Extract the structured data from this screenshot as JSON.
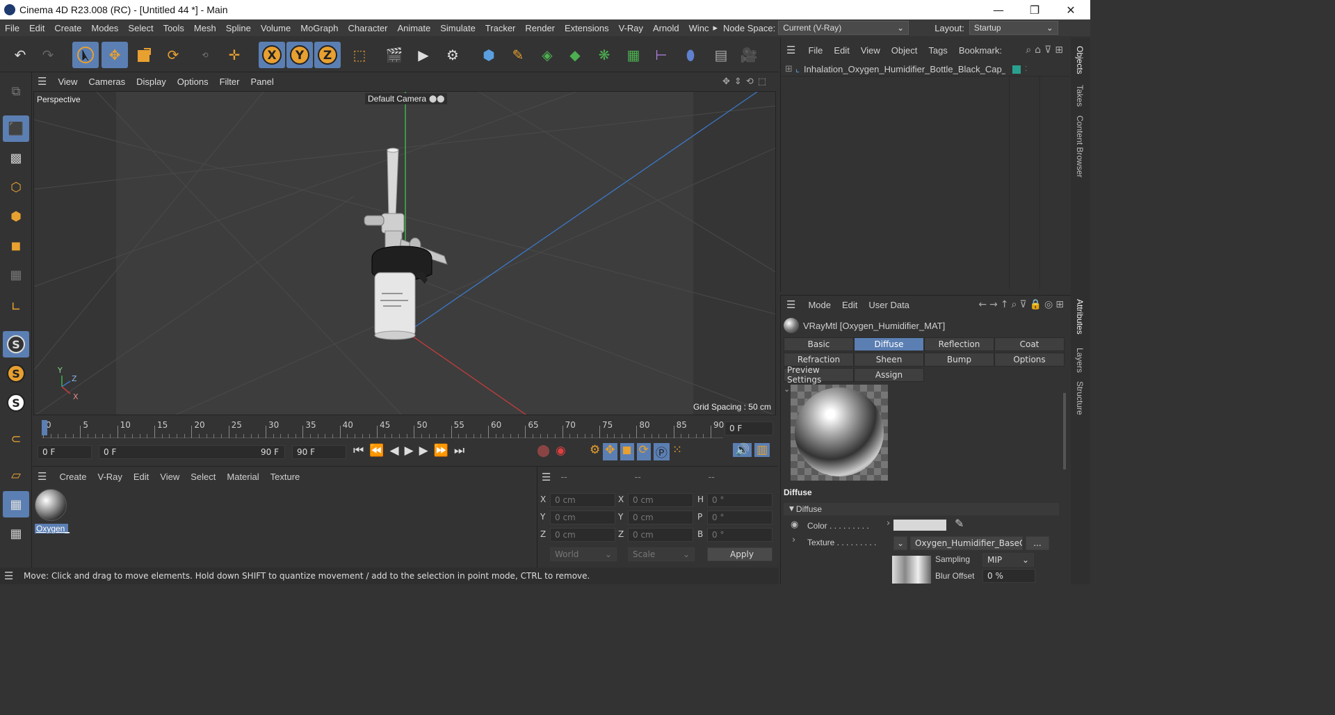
{
  "window": {
    "title": "Cinema 4D R23.008 (RC) - [Untitled 44 *] - Main",
    "minimize": "—",
    "maximize": "❐",
    "close": "✕"
  },
  "menu": {
    "items": [
      "File",
      "Edit",
      "Create",
      "Modes",
      "Select",
      "Tools",
      "Mesh",
      "Spline",
      "Volume",
      "MoGraph",
      "Character",
      "Animate",
      "Simulate",
      "Tracker",
      "Render",
      "Extensions",
      "V-Ray",
      "Arnold",
      "Winc"
    ],
    "overflow": "▸",
    "node_space_label": "Node Space:",
    "node_space_value": "Current (V-Ray)",
    "layout_label": "Layout:",
    "layout_value": "Startup"
  },
  "viewport": {
    "menu": [
      "View",
      "Cameras",
      "Display",
      "Options",
      "Filter",
      "Panel"
    ],
    "label": "Perspective",
    "camera": "Default Camera",
    "grid": "Grid Spacing : 50 cm",
    "axis_y": "Y",
    "axis_z": "Z",
    "axis_x": "X"
  },
  "timeline": {
    "ticks": [
      "0",
      "5",
      "10",
      "15",
      "20",
      "25",
      "30",
      "35",
      "40",
      "45",
      "50",
      "55",
      "60",
      "65",
      "70",
      "75",
      "80",
      "85",
      "90"
    ],
    "current_frame": "0 F",
    "start": "0 F",
    "range_start": "0 F",
    "range_end": "90 F",
    "end": "90 F"
  },
  "material_manager": {
    "menu": [
      "Create",
      "V-Ray",
      "Edit",
      "View",
      "Select",
      "Material",
      "Texture"
    ],
    "material_name": "Oxygen_"
  },
  "coordinates": {
    "headers": [
      "--",
      "--",
      "--"
    ],
    "rows": [
      {
        "a": "X",
        "av": "0 cm",
        "b": "X",
        "bv": "0 cm",
        "c": "H",
        "cv": "0 °"
      },
      {
        "a": "Y",
        "av": "0 cm",
        "b": "Y",
        "bv": "0 cm",
        "c": "P",
        "cv": "0 °"
      },
      {
        "a": "Z",
        "av": "0 cm",
        "b": "Z",
        "bv": "0 cm",
        "c": "B",
        "cv": "0 °"
      }
    ],
    "world": "World",
    "scale": "Scale",
    "apply": "Apply"
  },
  "status": "Move: Click and drag to move elements. Hold down SHIFT to quantize movement / add to the selection in point mode, CTRL to remove.",
  "object_manager": {
    "menu": [
      "File",
      "Edit",
      "View",
      "Object",
      "Tags",
      "Bookmark:"
    ],
    "object_name": "Inhalation_Oxygen_Humidifier_Bottle_Black_Cap_g"
  },
  "attributes": {
    "menu": [
      "Mode",
      "Edit",
      "User Data"
    ],
    "material_title": "VRayMtl [Oxygen_Humidifier_MAT]",
    "tabs_row1": [
      "Basic",
      "Diffuse",
      "Reflection",
      "Coat"
    ],
    "tabs_row2": [
      "Refraction",
      "Sheen",
      "Bump",
      "Options"
    ],
    "tabs_row3": [
      "Preview Settings",
      "Assign"
    ],
    "section": "Diffuse",
    "subsection": "Diffuse",
    "color_label": "Color . . . . . . . . .",
    "texture_label": "Texture . . . . . . . . .",
    "texture_value": "Oxygen_Humidifier_BaseCol",
    "dots": "...",
    "sampling_label": "Sampling",
    "sampling_value": "MIP",
    "blur_label": "Blur Offset",
    "blur_value": "0 %"
  },
  "right_tabs": [
    "Objects",
    "Takes",
    "Content Browser",
    "Attributes",
    "Layers",
    "Structure"
  ],
  "colors": {
    "accent": "#5b7fb3",
    "axis_x": "#c83c3c",
    "axis_y": "#3cb44b",
    "axis_z": "#3c78c8",
    "swatch": "#d8d8d8"
  }
}
